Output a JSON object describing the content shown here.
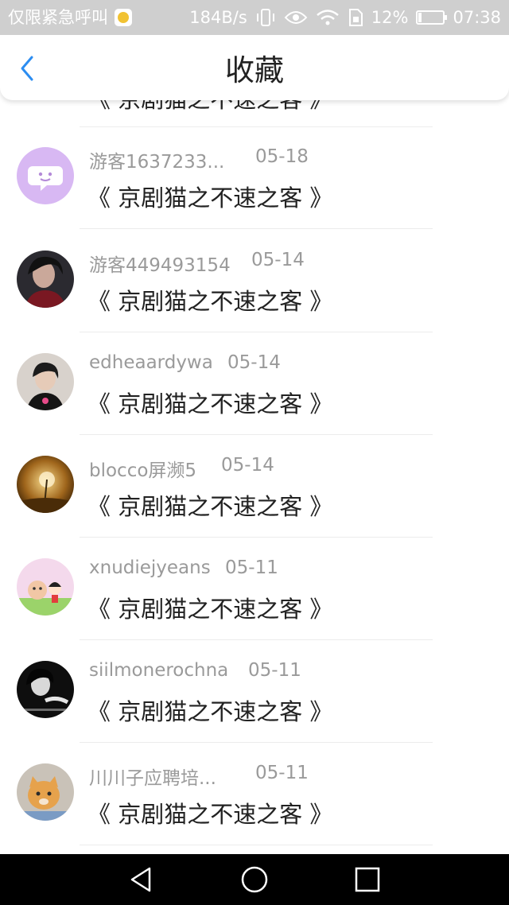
{
  "status_bar": {
    "carrier": "仅限紧急呼叫",
    "speed": "184B/s",
    "battery": "12%",
    "time": "07:38",
    "icons": [
      "app-notification-icon",
      "vibrate-icon",
      "eye-icon",
      "wifi-icon",
      "sim-icon",
      "battery-icon"
    ]
  },
  "header": {
    "title": "收藏",
    "back_icon": "chevron-left-icon",
    "accent_color": "#2c8df1"
  },
  "partial_item": {
    "title": "《 京剧猫之不速之客 》"
  },
  "items": [
    {
      "name": "游客1637233...",
      "date": "05-18",
      "title": "《 京剧猫之不速之客 》",
      "avatar": "default-chat-avatar"
    },
    {
      "name": "游客449493154",
      "date": "05-14",
      "title": "《 京剧猫之不速之客 》",
      "avatar": "photo-avatar-dark"
    },
    {
      "name": "edheaardywa",
      "date": "05-14",
      "title": "《 京剧猫之不速之客 》",
      "avatar": "photo-avatar-person"
    },
    {
      "name": "blocco屏濒5",
      "date": "05-14",
      "title": "《 京剧猫之不速之客 》",
      "avatar": "photo-avatar-dandelion"
    },
    {
      "name": "xnudiejyeans",
      "date": "05-11",
      "title": "《 京剧猫之不速之客 》",
      "avatar": "cartoon-avatar"
    },
    {
      "name": "siilmonerochna",
      "date": "05-11",
      "title": "《 京剧猫之不速之客 》",
      "avatar": "photo-avatar-bw"
    },
    {
      "name": "川川子应聘培...",
      "date": "05-11",
      "title": "《 京剧猫之不速之客 》",
      "avatar": "photo-avatar-kitten"
    }
  ],
  "nav_bar": {
    "icons": [
      "back-triangle-icon",
      "home-circle-icon",
      "recents-square-icon"
    ]
  }
}
